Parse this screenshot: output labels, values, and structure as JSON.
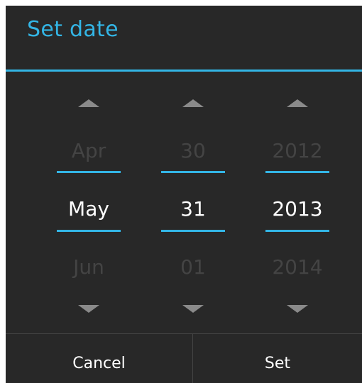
{
  "dialog": {
    "title": "Set date",
    "accent_color": "#33b5e5",
    "background_color": "#282828"
  },
  "pickers": {
    "month": {
      "prev": "Apr",
      "current": "May",
      "next": "Jun"
    },
    "day": {
      "prev": "30",
      "current": "31",
      "next": "01"
    },
    "year": {
      "prev": "2012",
      "current": "2013",
      "next": "2014"
    }
  },
  "icons": {
    "increment": "chevron-up-icon",
    "decrement": "chevron-down-icon"
  },
  "buttons": {
    "cancel_label": "Cancel",
    "set_label": "Set"
  }
}
